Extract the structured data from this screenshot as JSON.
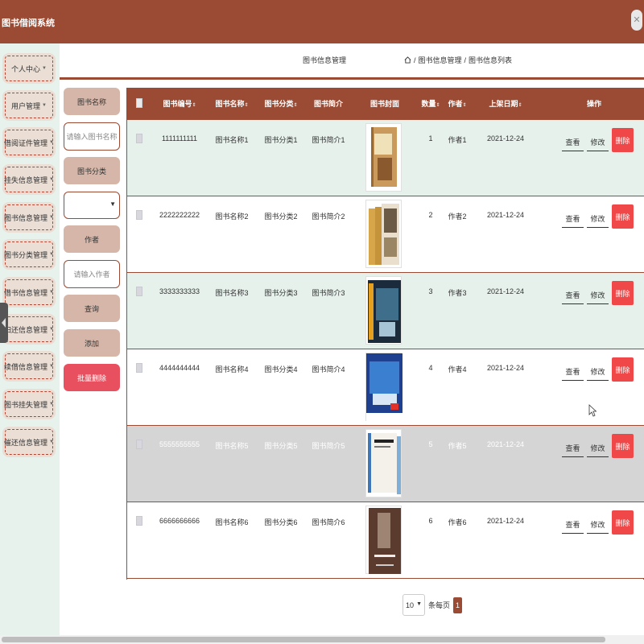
{
  "app": {
    "title": "图书借阅系统"
  },
  "sidebar": {
    "items": [
      {
        "label": "个人中心"
      },
      {
        "label": "用户管理"
      },
      {
        "label": "借阅证件管理"
      },
      {
        "label": "挂失信息管理"
      },
      {
        "label": "图书信息管理"
      },
      {
        "label": "图书分类管理"
      },
      {
        "label": "借书信息管理"
      },
      {
        "label": "归还信息管理"
      },
      {
        "label": "续借信息管理"
      },
      {
        "label": "图书挂失管理"
      },
      {
        "label": "催还信息管理"
      }
    ]
  },
  "breadcrumb": {
    "title": "图书信息管理",
    "sep1": "/",
    "level1": "图书信息管理",
    "sep2": "/",
    "level2": "图书信息列表"
  },
  "search": {
    "name_label": "图书名称",
    "name_placeholder": "请输入图书名称",
    "category_label": "图书分类",
    "category_value": "",
    "author_label": "作者",
    "author_placeholder": "请输入作者",
    "query_button": "查询",
    "add_button": "添加",
    "batch_delete_button": "批量删除"
  },
  "table": {
    "columns": [
      "图书编号",
      "图书名称",
      "图书分类",
      "图书简介",
      "图书封面",
      "数量",
      "作者",
      "上架日期",
      "操作"
    ],
    "sort_icon": "⇕",
    "rows": [
      {
        "id": "1111111111",
        "name": "图书名称1",
        "category": "图书分类1",
        "intro": "图书简介1",
        "qty": "1",
        "author": "作者1",
        "date": "2021-12-24"
      },
      {
        "id": "2222222222",
        "name": "图书名称2",
        "category": "图书分类2",
        "intro": "图书简介2",
        "qty": "2",
        "author": "作者2",
        "date": "2021-12-24"
      },
      {
        "id": "3333333333",
        "name": "图书名称3",
        "category": "图书分类3",
        "intro": "图书简介3",
        "qty": "3",
        "author": "作者3",
        "date": "2021-12-24"
      },
      {
        "id": "4444444444",
        "name": "图书名称4",
        "category": "图书分类4",
        "intro": "图书简介4",
        "qty": "4",
        "author": "作者4",
        "date": "2021-12-24"
      },
      {
        "id": "5555555555",
        "name": "图书名称5",
        "category": "图书分类5",
        "intro": "图书简介5",
        "qty": "5",
        "author": "作者5",
        "date": "2021-12-24"
      },
      {
        "id": "6666666666",
        "name": "图书名称6",
        "category": "图书分类6",
        "intro": "图书简介6",
        "qty": "6",
        "author": "作者6",
        "date": "2021-12-24"
      }
    ],
    "actions": {
      "view": "查看",
      "edit": "修改",
      "delete": "删除"
    }
  },
  "pager": {
    "page_size": "10",
    "page_size_label": "条每页",
    "current_page": "1"
  },
  "colors": {
    "brand": "#9b4a33",
    "sidebar_bg": "#e7f2ec",
    "button_bg": "#d6b6a8",
    "danger": "#f04848"
  }
}
